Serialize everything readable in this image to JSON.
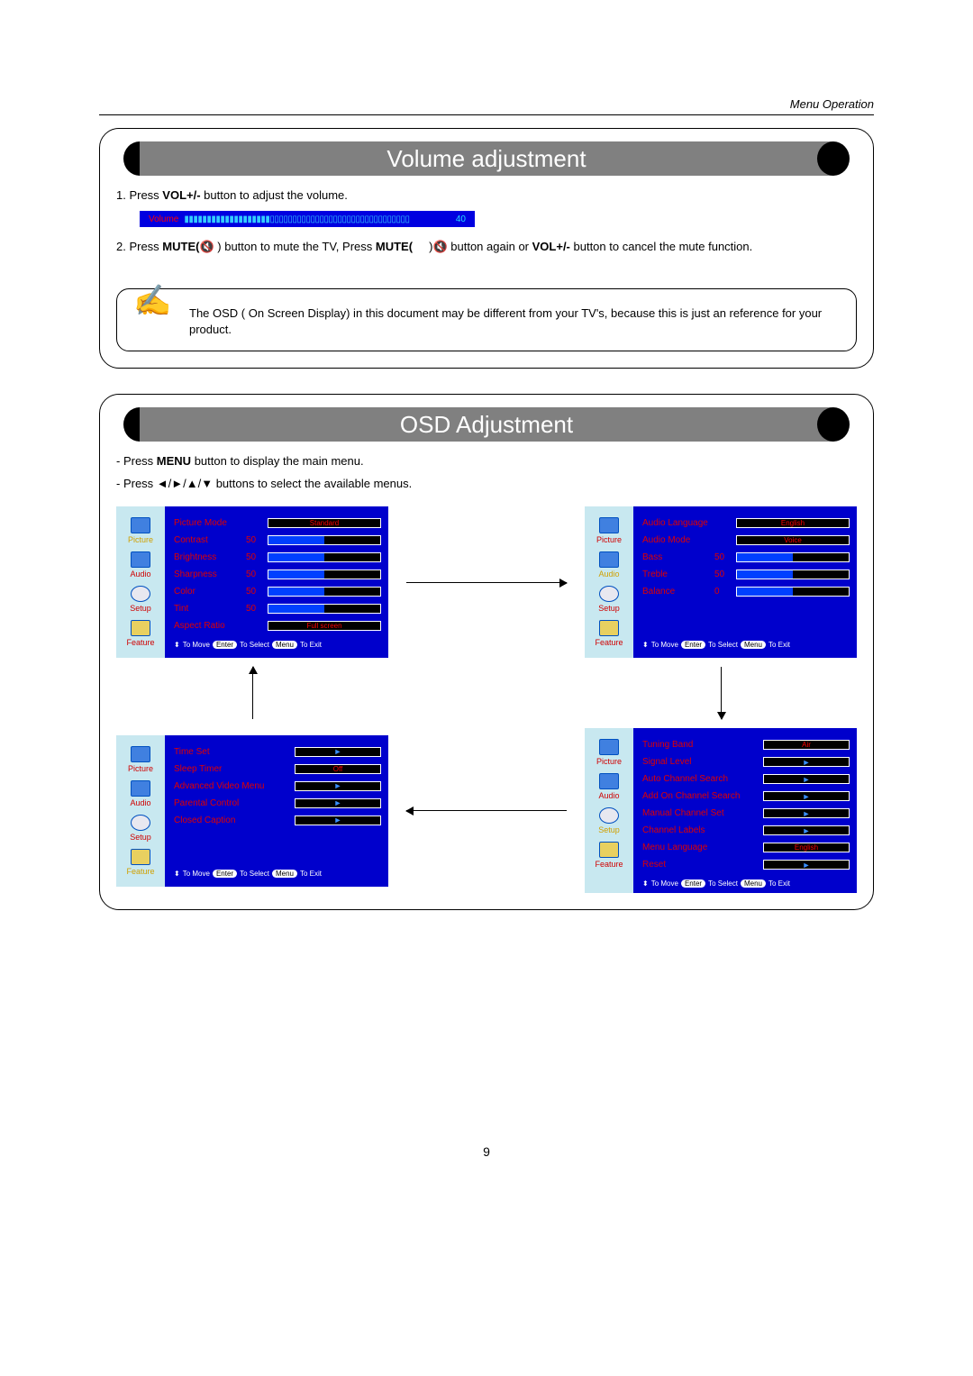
{
  "header": {
    "section_label": "Menu Operation"
  },
  "volume_section": {
    "title": "Volume adjustment",
    "step1_prefix": "1. Press ",
    "step1_bold": "VOL+/-",
    "step1_suffix": "   button  to adjust the volume.",
    "vol_label": "Volume",
    "vol_value": "40",
    "step2_a": "2. Press ",
    "step2_b": "MUTE(",
    "step2_c": " button to mute the TV, Press ",
    "step2_d": "MUTE(",
    "step2_e": " button again or ",
    "step2_f": "VOL+/-",
    "step2_g": " button to cancel the mute function.",
    "mute_close": " )",
    "note": "The OSD ( On Screen Display)  in this document may be different from your TV's, because this is just an reference for your product."
  },
  "osd_section": {
    "title": "OSD Adjustment",
    "line1_a": "- Press  ",
    "line1_b": "MENU",
    "line1_c": " button to display the main menu.",
    "line2": "- Press  ◄/►/▲/▼ buttons to select the available menus."
  },
  "sidebar": {
    "picture": "Picture",
    "audio": "Audio",
    "setup": "Setup",
    "feature": "Feature"
  },
  "footer": {
    "move": "To Move",
    "enter": "Enter",
    "select": "To Select",
    "menu": "Menu",
    "exit": "To Exit",
    "arrows": "⬍"
  },
  "picture_menu": {
    "items": [
      {
        "label": "Picture Mode",
        "value": "",
        "field": "Standard"
      },
      {
        "label": "Contrast",
        "value": "50",
        "field": ""
      },
      {
        "label": "Brightness",
        "value": "50",
        "field": ""
      },
      {
        "label": "Sharpness",
        "value": "50",
        "field": ""
      },
      {
        "label": "Color",
        "value": "50",
        "field": ""
      },
      {
        "label": "Tint",
        "value": "50",
        "field": ""
      },
      {
        "label": "Aspect Ratio",
        "value": "",
        "field": "Full screen"
      }
    ]
  },
  "audio_menu": {
    "items": [
      {
        "label": "Audio Language",
        "value": "",
        "field": "English"
      },
      {
        "label": "Audio Mode",
        "value": "",
        "field": "Voice"
      },
      {
        "label": "Bass",
        "value": "50",
        "field": ""
      },
      {
        "label": "Treble",
        "value": "50",
        "field": ""
      },
      {
        "label": "Balance",
        "value": "0",
        "field": ""
      }
    ]
  },
  "feature_menu": {
    "items": [
      {
        "label": "Time Set",
        "field": "►"
      },
      {
        "label": "Sleep Timer",
        "field": "Off"
      },
      {
        "label": "Advanced Video Menu",
        "field": "►"
      },
      {
        "label": "Parental Control",
        "field": "►"
      },
      {
        "label": "Closed Caption",
        "field": "►"
      }
    ]
  },
  "setup_menu": {
    "items": [
      {
        "label": "Tuning Band",
        "field": "Air"
      },
      {
        "label": "Signal Level",
        "field": "►"
      },
      {
        "label": "Auto Channel Search",
        "field": "►"
      },
      {
        "label": "Add On Channel Search",
        "field": "►"
      },
      {
        "label": "Manual Channel Set",
        "field": "►"
      },
      {
        "label": "Channel Labels",
        "field": "►"
      },
      {
        "label": "Menu Language",
        "field": "English"
      },
      {
        "label": "Reset",
        "field": "►"
      }
    ]
  },
  "page_number": "9"
}
